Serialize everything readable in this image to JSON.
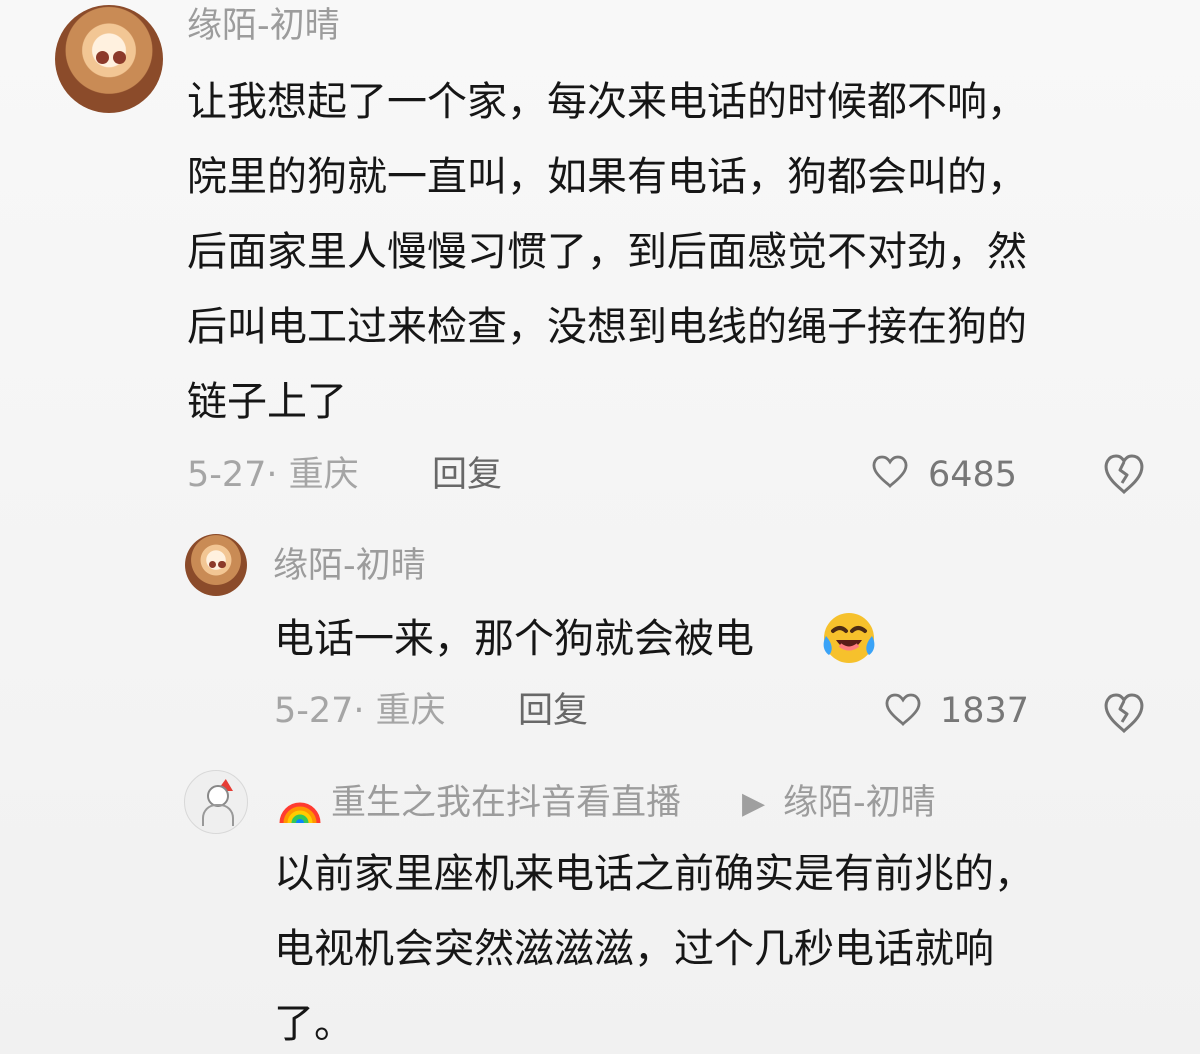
{
  "comments": [
    {
      "user": "缘陌-初晴",
      "text_lines": [
        "让我想起了一个家，每次来电话的时候都不响，",
        "院里的狗就一直叫，如果有电话，狗都会叫的，",
        "后面家里人慢慢习惯了，到后面感觉不对劲，然",
        "后叫电工过来检查，没想到电线的绳子接在狗的",
        "链子上了"
      ],
      "meta": "5-27· 重庆",
      "reply": "回复",
      "likes": "6485"
    },
    {
      "user": "缘陌-初晴",
      "text": "电话一来，那个狗就会被电",
      "meta": "5-27· 重庆",
      "reply": "回复",
      "likes": "1837"
    },
    {
      "user": "重生之我在抖音看直播",
      "reply_to": "缘陌-初晴",
      "text_lines": [
        "以前家里座机来电话之前确实是有前兆的，",
        "电视机会突然滋滋滋，过个几秒电话就响",
        "了。"
      ]
    }
  ],
  "icons": {
    "heart": "heart-outline-icon",
    "dislike": "broken-heart-icon",
    "rainbow": "rainbow-emoji-icon",
    "laugh": "laughing-emoji-icon",
    "reply_arrow": "reply-arrow-icon"
  },
  "colors": {
    "background": "#f5f5f5",
    "primary_text": "#161616",
    "secondary_text": "#a5a5a5",
    "reply_text": "#686868"
  }
}
